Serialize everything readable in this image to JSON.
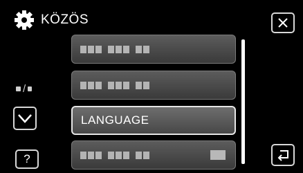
{
  "header": {
    "title": "KÖZÖS",
    "icon": "gear-icon"
  },
  "close_button": {
    "icon": "close-icon"
  },
  "page_indicator": {
    "separator": "/"
  },
  "down_button": {
    "icon": "chevron-down-icon"
  },
  "help_button": {
    "label": "?"
  },
  "back_button": {
    "icon": "return-icon"
  },
  "menu": {
    "items": [
      {
        "label": "",
        "obscured": true
      },
      {
        "label": "",
        "obscured": true
      },
      {
        "label": "LANGUAGE",
        "selected": true
      },
      {
        "label": "",
        "obscured": true,
        "has_toggle": true
      }
    ]
  },
  "colors": {
    "background": "#000000",
    "item_bg": "#4a4a4a",
    "text": "#ffffff",
    "border": "#d8d8d8"
  }
}
